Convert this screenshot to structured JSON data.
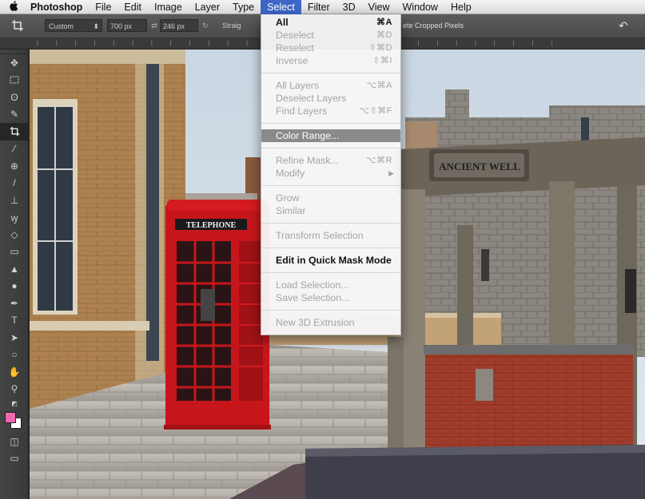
{
  "menubar": {
    "apple": "",
    "items": [
      "Photoshop",
      "File",
      "Edit",
      "Image",
      "Layer",
      "Type",
      "Select",
      "Filter",
      "3D",
      "View",
      "Window",
      "Help"
    ],
    "active": "Select"
  },
  "options": {
    "ratio": "Custom",
    "width": "700 px",
    "height": "246 px",
    "straighten": "Straig",
    "delete_cropped": "ete Cropped Pixels"
  },
  "select_menu": {
    "groups": [
      [
        {
          "label": "All",
          "shortcut": "⌘A",
          "state": "bold"
        },
        {
          "label": "Deselect",
          "shortcut": "⌘D",
          "state": "disabled"
        },
        {
          "label": "Reselect",
          "shortcut": "⇧⌘D",
          "state": "disabled"
        },
        {
          "label": "Inverse",
          "shortcut": "⇧⌘I",
          "state": "disabled"
        }
      ],
      [
        {
          "label": "All Layers",
          "shortcut": "⌥⌘A",
          "state": "disabled"
        },
        {
          "label": "Deselect Layers",
          "shortcut": "",
          "state": "disabled"
        },
        {
          "label": "Find Layers",
          "shortcut": "⌥⇧⌘F",
          "state": "disabled"
        }
      ],
      [
        {
          "label": "Color Range...",
          "shortcut": "",
          "state": "highlighted"
        }
      ],
      [
        {
          "label": "Refine Mask...",
          "shortcut": "⌥⌘R",
          "state": "disabled"
        },
        {
          "label": "Modify",
          "shortcut": "",
          "state": "disabled",
          "submenu": true
        }
      ],
      [
        {
          "label": "Grow",
          "shortcut": "",
          "state": "disabled"
        },
        {
          "label": "Similar",
          "shortcut": "",
          "state": "disabled"
        }
      ],
      [
        {
          "label": "Transform Selection",
          "shortcut": "",
          "state": "disabled"
        }
      ],
      [
        {
          "label": "Edit in Quick Mask Mode",
          "shortcut": "",
          "state": "bold"
        }
      ],
      [
        {
          "label": "Load Selection...",
          "shortcut": "",
          "state": "disabled"
        },
        {
          "label": "Save Selection...",
          "shortcut": "",
          "state": "disabled"
        }
      ],
      [
        {
          "label": "New 3D Extrusion",
          "shortcut": "",
          "state": "disabled"
        }
      ]
    ]
  },
  "photo": {
    "telephone_sign": "TELEPHONE",
    "well_sign": "ANCIENT WELL"
  },
  "colors": {
    "menu_highlight": "#3f66c7",
    "foreground": "#f06ab0",
    "background": "#ffffff"
  }
}
